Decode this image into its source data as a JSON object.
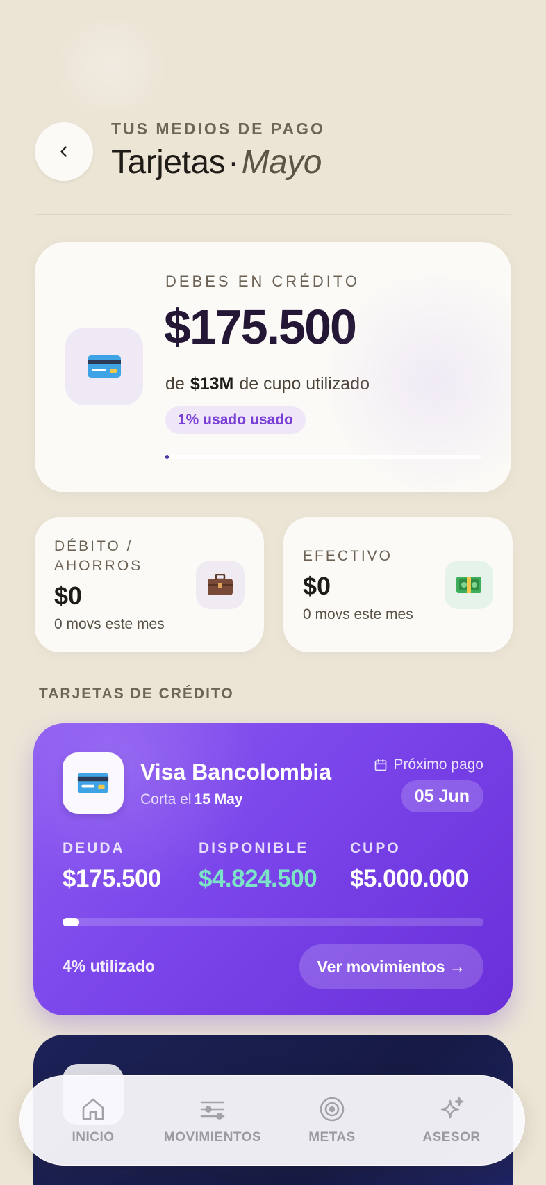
{
  "header": {
    "eyebrow": "TUS MEDIOS DE PAGO",
    "title": "Tarjetas",
    "separator": "·",
    "month": "Mayo"
  },
  "credit_summary": {
    "label": "DEBES EN CRÉDITO",
    "amount": "$175.500",
    "sub_prefix": "de",
    "sub_limit": "$13M",
    "sub_suffix": "de cupo utilizado",
    "pill_a": "1% usado",
    "pill_b": "usado",
    "usage_fraction": 0.01,
    "icon": "credit-card-icon"
  },
  "debit": {
    "label": "DÉBITO / AHORROS",
    "amount": "$0",
    "sub": "0 movs este mes",
    "icon": "briefcase-icon"
  },
  "cash": {
    "label": "EFECTIVO",
    "amount": "$0",
    "sub": "0 movs este mes",
    "icon": "money-icon"
  },
  "section": {
    "credit_cards_title": "TARJETAS DE CRÉDITO"
  },
  "cards": [
    {
      "name": "Visa Bancolombia",
      "cut_prefix": "Corta el",
      "cut_date": "15 May",
      "next_pay_label": "Próximo pago",
      "next_pay_date": "05 Jun",
      "debt_label": "DEUDA",
      "debt": "$175.500",
      "available_label": "DISPONIBLE",
      "available": "$4.824.500",
      "limit_label": "CUPO",
      "limit": "$5.000.000",
      "usage_fraction": 0.04,
      "used_text": "4% utilizado",
      "button_label": "Ver movimientos →",
      "colors": {
        "from": "#8e5cf2",
        "to": "#6a2fd9"
      }
    }
  ],
  "nav": [
    {
      "label": "INICIO",
      "icon": "home-icon"
    },
    {
      "label": "MOVIMIENTOS",
      "icon": "sliders-icon"
    },
    {
      "label": "METAS",
      "icon": "target-icon"
    },
    {
      "label": "ASESOR",
      "icon": "sparkle-icon"
    }
  ],
  "colors": {
    "background": "#ece5d6",
    "accent": "#7a3fd6",
    "available_green": "#7de3c8"
  }
}
